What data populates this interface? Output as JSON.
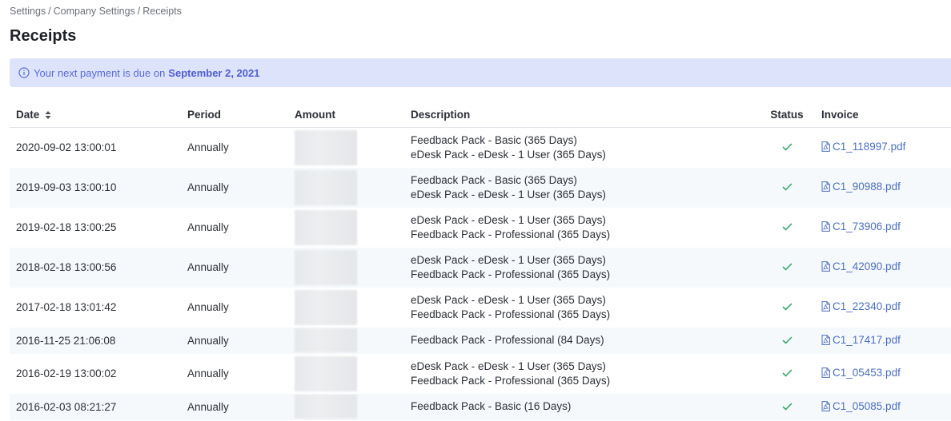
{
  "breadcrumb": [
    "Settings",
    "Company Settings",
    "Receipts"
  ],
  "page_title": "Receipts",
  "banner": {
    "icon": "info-icon",
    "text": "Your next payment is due on",
    "date": "September 2, 2021"
  },
  "table": {
    "headers": {
      "date": "Date",
      "period": "Period",
      "amount": "Amount",
      "description": "Description",
      "status": "Status",
      "invoice": "Invoice"
    },
    "rows": [
      {
        "date": "2020-09-02 13:00:01",
        "period": "Annually",
        "desc1": "Feedback Pack - Basic (365 Days)",
        "desc2": "eDesk Pack - eDesk - 1 User (365 Days)",
        "invoice": "C1_118997.pdf"
      },
      {
        "date": "2019-09-03 13:00:10",
        "period": "Annually",
        "desc1": "Feedback Pack - Basic (365 Days)",
        "desc2": "eDesk Pack - eDesk - 1 User (365 Days)",
        "invoice": "C1_90988.pdf"
      },
      {
        "date": "2019-02-18 13:00:25",
        "period": "Annually",
        "desc1": "eDesk Pack - eDesk - 1 User (365 Days)",
        "desc2": "Feedback Pack - Professional (365 Days)",
        "invoice": "C1_73906.pdf"
      },
      {
        "date": "2018-02-18 13:00:56",
        "period": "Annually",
        "desc1": "eDesk Pack - eDesk - 1 User (365 Days)",
        "desc2": "Feedback Pack - Professional (365 Days)",
        "invoice": "C1_42090.pdf"
      },
      {
        "date": "2017-02-18 13:01:42",
        "period": "Annually",
        "desc1": "eDesk Pack - eDesk - 1 User (365 Days)",
        "desc2": "Feedback Pack - Professional (365 Days)",
        "invoice": "C1_22340.pdf"
      },
      {
        "date": "2016-11-25 21:06:08",
        "period": "Annually",
        "desc1": "Feedback Pack - Professional (84 Days)",
        "desc2": "",
        "invoice": "C1_17417.pdf"
      },
      {
        "date": "2016-02-19 13:00:02",
        "period": "Annually",
        "desc1": "eDesk Pack - eDesk - 1 User (365 Days)",
        "desc2": "Feedback Pack - Professional (365 Days)",
        "invoice": "C1_05453.pdf"
      },
      {
        "date": "2016-02-03 08:21:27",
        "period": "Annually",
        "desc1": "Feedback Pack - Basic (16 Days)",
        "desc2": "",
        "invoice": "C1_05085.pdf"
      }
    ]
  },
  "colors": {
    "banner_bg": "#dde3fb",
    "banner_text": "#5b6bd6",
    "link": "#4c6fbf",
    "check": "#3aa76d"
  }
}
